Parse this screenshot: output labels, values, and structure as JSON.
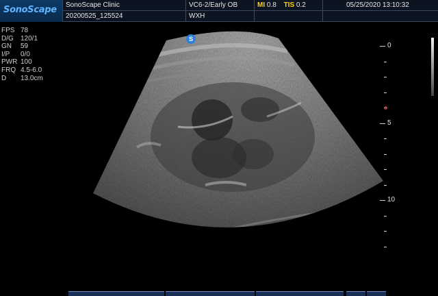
{
  "header": {
    "logo": "SonoScape",
    "clinic": "SonoScape Clinic",
    "patient_id": "20200525_125524",
    "probe_preset": "VC6-2/Early OB",
    "patient_name": "WXH",
    "mi_label": "MI",
    "mi_value": "0.8",
    "tis_label": "TIS",
    "tis_value": "0.2",
    "datetime": "05/25/2020 13:10:32"
  },
  "params": [
    {
      "label": "FPS",
      "value": "78"
    },
    {
      "label": "D/G",
      "value": "120/1"
    },
    {
      "label": "GN",
      "value": "59"
    },
    {
      "label": "I/P",
      "value": "0/0"
    },
    {
      "label": "PWR",
      "value": "100"
    },
    {
      "label": "FRQ",
      "value": "4.5-6.0"
    },
    {
      "label": "D",
      "value": "13.0cm"
    }
  ],
  "probe_orientation_badge": "S",
  "depth_scale": {
    "labels": [
      "0",
      "5",
      "10"
    ],
    "max_cm": 13,
    "focus_cm": 4
  },
  "colors": {
    "header_bg": "#0b1420",
    "logo_text": "#5fb4ff",
    "index_label": "#ffd400",
    "badge": "#2f7fd8",
    "focus_marker": "#dd3333"
  }
}
